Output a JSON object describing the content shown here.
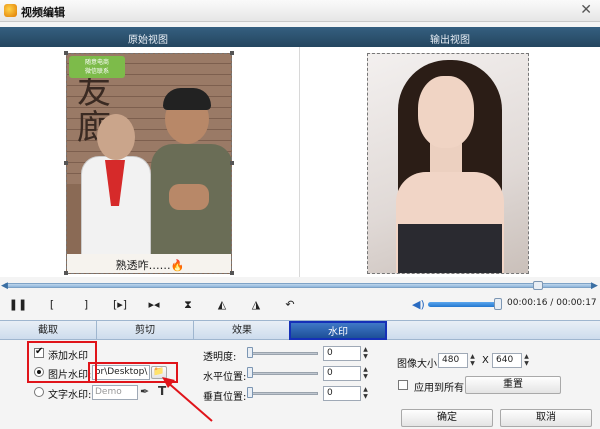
{
  "window": {
    "title": "视频编辑"
  },
  "preview": {
    "original_label": "原始视图",
    "output_label": "输出视图",
    "subtitle": "熟透咋……🔥",
    "wall_text": "友\n廊",
    "watermark_logo": "随意电商\n微信联系"
  },
  "playback": {
    "time_current": "00:00:16",
    "time_total": "00:00:17",
    "time_separator": "/"
  },
  "tabs": [
    {
      "label": "截取"
    },
    {
      "label": "剪切"
    },
    {
      "label": "效果"
    },
    {
      "label": "水印",
      "active": true
    }
  ],
  "watermark": {
    "add_label": "添加水印",
    "add_checked": true,
    "image_label": "图片水印:",
    "image_path": "or\\Desktop\\",
    "text_label": "文字水印:",
    "text_placeholder": "Demo",
    "transparency_label": "透明度:",
    "transparency_value": "0",
    "h_position_label": "水平位置:",
    "h_position_value": "0",
    "v_position_label": "垂直位置:",
    "v_position_value": "0",
    "size_label": "图像大小:",
    "width": "480",
    "x_label": "X",
    "height": "640",
    "apply_all_label": "应用到所有",
    "reset_label": "重置"
  },
  "footer": {
    "ok_label": "确定",
    "cancel_label": "取消"
  },
  "colors": {
    "active_tab": "#1d4f98",
    "highlight": "#e0141a",
    "header_bar": "#2d5273"
  }
}
